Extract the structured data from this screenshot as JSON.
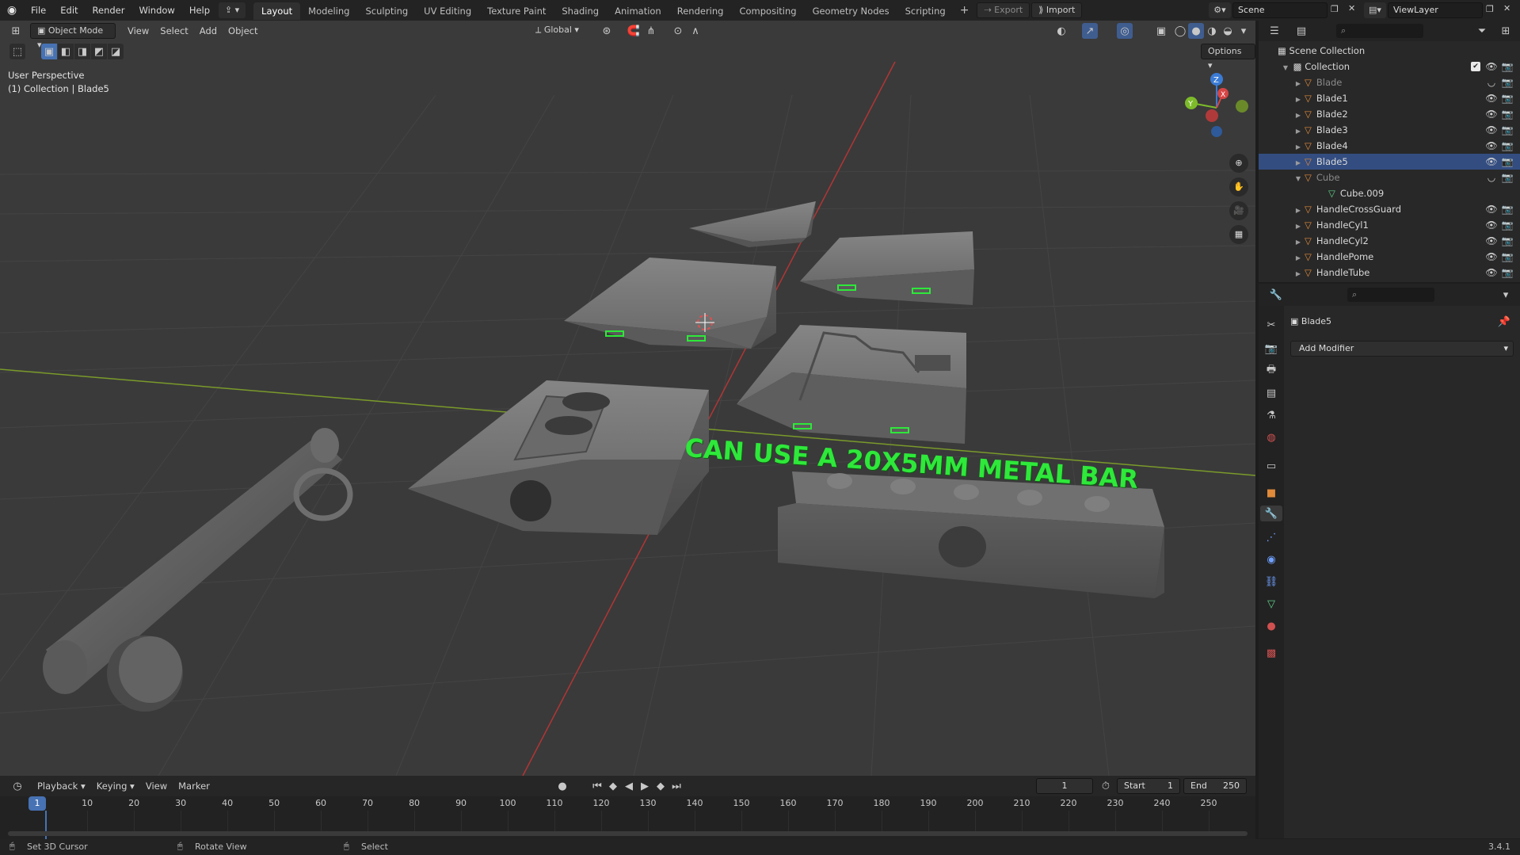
{
  "topbar": {
    "menus": [
      "File",
      "Edit",
      "Render",
      "Window",
      "Help"
    ],
    "workspaces": [
      "Layout",
      "Modeling",
      "Sculpting",
      "UV Editing",
      "Texture Paint",
      "Shading",
      "Animation",
      "Rendering",
      "Compositing",
      "Geometry Nodes",
      "Scripting"
    ],
    "active_workspace": "Layout",
    "export_label": "Export",
    "import_label": "Import",
    "scene_value": "Scene",
    "viewlayer_value": "ViewLayer"
  },
  "viewport": {
    "mode": "Object Mode",
    "menus": [
      "View",
      "Select",
      "Add",
      "Object"
    ],
    "orientation": "Global",
    "options_label": "Options",
    "perspective_label": "User Perspective",
    "context_label": "(1) Collection | Blade5",
    "annotation": "CAN USE A 20X5MM METAL BAR",
    "gizmo": {
      "z": "Z",
      "y": "Y",
      "x": "X"
    },
    "colors": {
      "annotation": "#2ee83a",
      "x_axis": "#c33a3a",
      "y_axis": "#7a9a2a",
      "bg": "#3a3a3a",
      "grid": "#464646",
      "mesh": "#6e6e6e"
    }
  },
  "outliner": {
    "root": "Scene Collection",
    "collection": "Collection",
    "items": [
      {
        "name": "Blade",
        "disabled": true
      },
      {
        "name": "Blade1"
      },
      {
        "name": "Blade2"
      },
      {
        "name": "Blade3"
      },
      {
        "name": "Blade4"
      },
      {
        "name": "Blade5",
        "selected": true
      },
      {
        "name": "Cube",
        "disabled": true,
        "expanded": true
      },
      {
        "name": "Cube.009",
        "child": true
      },
      {
        "name": "HandleCrossGuard"
      },
      {
        "name": "HandleCyl1"
      },
      {
        "name": "HandleCyl2"
      },
      {
        "name": "HandlePome"
      },
      {
        "name": "HandleTube"
      }
    ]
  },
  "properties": {
    "object_name": "Blade5",
    "add_modifier": "Add Modifier"
  },
  "timeline": {
    "menus": [
      "Playback",
      "Keying",
      "View",
      "Marker"
    ],
    "current_frame": "1",
    "start_label": "Start",
    "start_value": "1",
    "end_label": "End",
    "end_value": "250",
    "ticks": [
      "1",
      "10",
      "20",
      "30",
      "40",
      "50",
      "60",
      "70",
      "80",
      "90",
      "100",
      "110",
      "120",
      "130",
      "140",
      "150",
      "160",
      "170",
      "180",
      "190",
      "200",
      "210",
      "220",
      "230",
      "240",
      "250"
    ]
  },
  "statusbar": {
    "left": "Set 3D Cursor",
    "middle": "Rotate View",
    "right": "Select",
    "version": "3.4.1"
  }
}
